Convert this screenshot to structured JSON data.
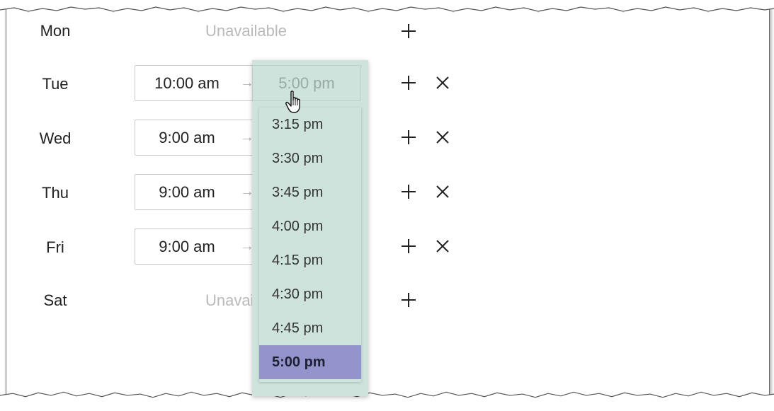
{
  "unavailable_text": "Unavailable",
  "arrow": "→",
  "days": [
    {
      "label": "Mon",
      "available": false
    },
    {
      "label": "Tue",
      "available": true,
      "start": "10:00 am",
      "end": "5:00 pm"
    },
    {
      "label": "Wed",
      "available": true,
      "start": "9:00 am"
    },
    {
      "label": "Thu",
      "available": true,
      "start": "9:00 am"
    },
    {
      "label": "Fri",
      "available": true,
      "start": "9:00 am"
    },
    {
      "label": "Sat",
      "available": false,
      "unavailable_partial": "Unavail"
    }
  ],
  "dropdown": {
    "options": [
      "3:15 pm",
      "3:30 pm",
      "3:45 pm",
      "4:00 pm",
      "4:15 pm",
      "4:30 pm",
      "4:45 pm",
      "5:00 pm"
    ],
    "selected": "5:00 pm"
  },
  "icons": {
    "add": "plus-icon",
    "remove": "x-icon",
    "cursor": "hand-pointer-icon"
  },
  "colors": {
    "dropdown_bg": "#cde3dc",
    "selected_bg": "#9494cc",
    "muted_text": "#b9b9b9"
  }
}
